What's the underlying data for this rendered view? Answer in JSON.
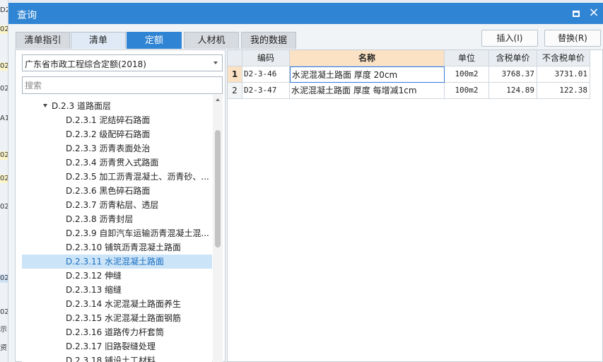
{
  "dialog": {
    "title": "查询"
  },
  "tabs": [
    {
      "label": "清单指引",
      "active": false
    },
    {
      "label": "清单",
      "active": false
    },
    {
      "label": "定额",
      "active": true
    },
    {
      "label": "人材机",
      "active": false
    },
    {
      "label": "我的数据",
      "active": false
    }
  ],
  "actions": {
    "insert_label": "插入(I)",
    "replace_label": "替换(R)"
  },
  "left_panel": {
    "quota_library": "广东省市政工程综合定额(2018)",
    "search_placeholder": "搜索",
    "tree_parent": "D.2.3 道路面层",
    "tree_items": [
      {
        "label": "D.2.3.1 泥结碎石路面"
      },
      {
        "label": "D.2.3.2 级配碎石路面"
      },
      {
        "label": "D.2.3.3 沥青表面处治"
      },
      {
        "label": "D.2.3.4 沥青贯入式路面"
      },
      {
        "label": "D.2.3.5 加工沥青混凝土、沥青砂、..."
      },
      {
        "label": "D.2.3.6 黑色碎石路面"
      },
      {
        "label": "D.2.3.7 沥青粘层、透层"
      },
      {
        "label": "D.2.3.8 沥青封层"
      },
      {
        "label": "D.2.3.9 自卸汽车运输沥青混凝土混..."
      },
      {
        "label": "D.2.3.10 铺筑沥青混凝土路面"
      },
      {
        "label": "D.2.3.11 水泥混凝土路面",
        "selected": true
      },
      {
        "label": "D.2.3.12 伸缝"
      },
      {
        "label": "D.2.3.13 缩缝"
      },
      {
        "label": "D.2.3.14 水泥混凝土路面养生"
      },
      {
        "label": "D.2.3.15 水泥混凝土路面钢筋"
      },
      {
        "label": "D.2.3.16 道路传力杆套筒"
      },
      {
        "label": "D.2.3.17 旧路裂缝处理"
      },
      {
        "label": "D.2.3.18 铺设土工材料"
      }
    ]
  },
  "grid": {
    "headers": {
      "code": "编码",
      "name": "名称",
      "unit": "单位",
      "price_with_tax": "含税单价",
      "price_without_tax": "不含税单价"
    },
    "rows": [
      {
        "no": "1",
        "code": "D2-3-46",
        "name": "水泥混凝土路面 厚度 20cm",
        "unit": "100m2",
        "price_with_tax": "3768.37",
        "price_without_tax": "3731.01"
      },
      {
        "no": "2",
        "code": "D2-3-47",
        "name": "水泥混凝土路面 厚度 每增减1cm",
        "unit": "100m2",
        "price_with_tax": "124.89",
        "price_without_tax": "122.38"
      }
    ]
  },
  "background_strip": [
    "D2",
    "02",
    "02",
    "A1",
    "02",
    "02",
    "02",
    "02",
    "02",
    "示",
    "资",
    "02"
  ],
  "colors": {
    "accent": "#2f84d3",
    "header_highlight": "#fbe2c4",
    "selection": "#cce4f7"
  }
}
